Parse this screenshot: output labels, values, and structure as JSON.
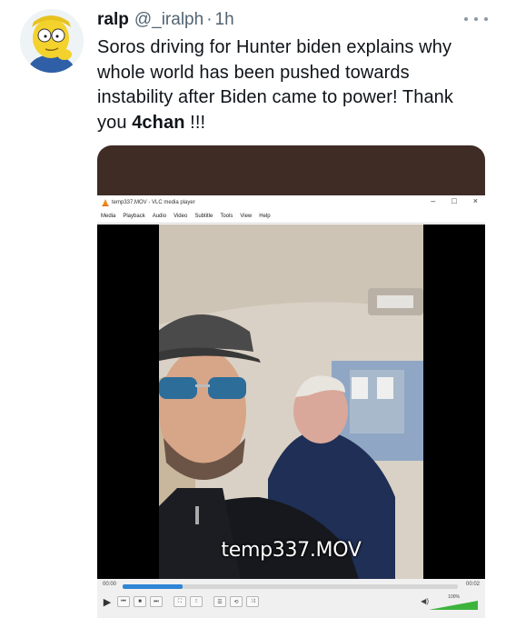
{
  "user": {
    "display_name": "ralp",
    "handle": "@_iralph",
    "separator": "·",
    "time": "1h"
  },
  "tweet": {
    "text_before": "Soros driving for Hunter biden explains why whole world has been pushed towards instability after Biden came to power! Thank you ",
    "text_bold": "4chan",
    "text_after": " !!!"
  },
  "vlc": {
    "window_title": "temp337.MOV - VLC media player",
    "window_controls": [
      "–",
      "□",
      "×"
    ],
    "menu": [
      "Media",
      "Playback",
      "Audio",
      "Video",
      "Subtitle",
      "Tools",
      "View",
      "Help"
    ],
    "overlay_title": "temp337.MOV",
    "time_elapsed": "00:00",
    "time_total": "00:02",
    "progress": 0.18,
    "volume_label": "100%",
    "volume": 1.0,
    "buttons": [
      "▶",
      "⏮",
      "■",
      "⏭",
      "⛶",
      "⫶⫶",
      "☰",
      "⟲",
      "⤨"
    ]
  }
}
